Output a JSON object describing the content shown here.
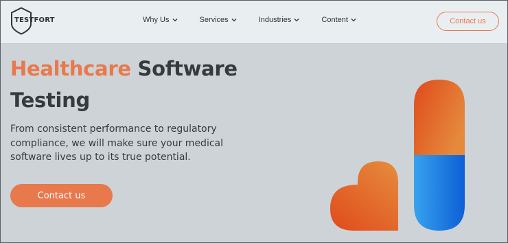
{
  "header": {
    "logo_text": "TESTFORT",
    "nav_items": [
      {
        "label": "Why Us"
      },
      {
        "label": "Services"
      },
      {
        "label": "Industries"
      },
      {
        "label": "Content"
      }
    ],
    "contact_label": "Contact us"
  },
  "hero": {
    "title_accent": "Healthcare",
    "title_rest": "Software Testing",
    "description": "From consistent performance to regulatory compliance, we will make sure your medical software lives up to its true potential.",
    "cta_label": "Contact us"
  },
  "illustration": {
    "icons": [
      "heart-icon",
      "capsule-icon"
    ]
  },
  "colors": {
    "accent": "#e8794c",
    "navbar_bg": "#e9eef1",
    "hero_bg": "#cdd3d7",
    "text": "#363a3d",
    "capsule_blue": "#2b8fe6"
  }
}
